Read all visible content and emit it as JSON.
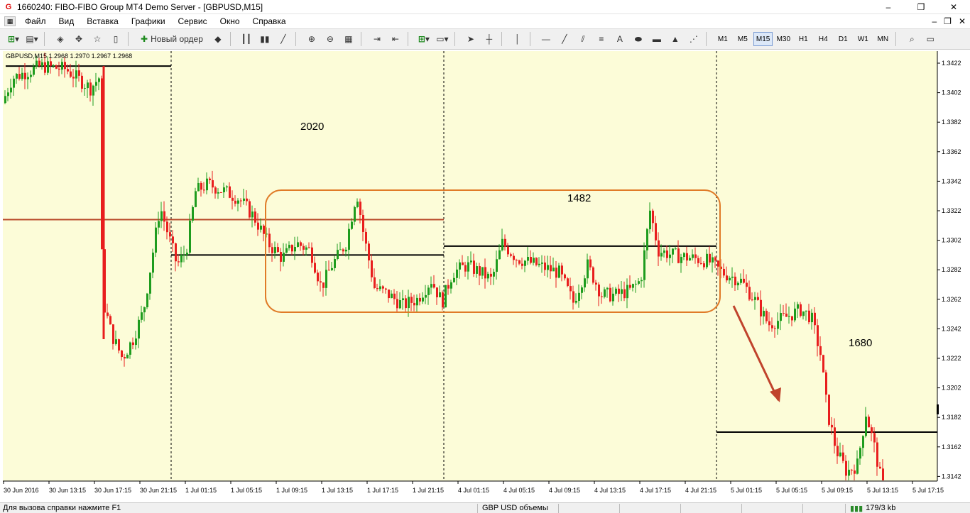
{
  "window": {
    "title": "1660240: FIBO-FIBO Group MT4 Demo Server - [GBPUSD,M15]",
    "controls": [
      "–",
      "❐",
      "✕"
    ]
  },
  "menu": {
    "items": [
      "Файл",
      "Вид",
      "Вставка",
      "Графики",
      "Сервис",
      "Окно",
      "Справка"
    ],
    "mdi_controls": [
      "–",
      "❐",
      "✕"
    ]
  },
  "toolbar": {
    "new_order_label": "Новый ордер",
    "timeframes": [
      "M1",
      "M5",
      "M15",
      "M30",
      "H1",
      "H4",
      "D1",
      "W1",
      "MN"
    ],
    "active_timeframe": "M15",
    "text_tool": "A"
  },
  "chart": {
    "info": "GBPUSD,M15  1.2968 1.2970 1.2967 1.2968",
    "colors": {
      "background": "#fcfcd8",
      "bull": "#1e9c1e",
      "bear": "#e81e1e",
      "range": "#e07b28",
      "arrow": "#c0432c",
      "level": "#b84a2a"
    },
    "annotations": [
      "2020",
      "1482",
      "1680"
    ],
    "price_labels": [
      "1.3422",
      "1.3402",
      "1.3382",
      "1.3362",
      "1.3342",
      "1.3322",
      "1.3302",
      "1.3282",
      "1.3262",
      "1.3242",
      "1.3222",
      "1.3202",
      "1.3182",
      "1.3162",
      "1.3142"
    ],
    "time_labels": [
      "30 Jun 2016",
      "30 Jun 13:15",
      "30 Jun 17:15",
      "30 Jun 21:15",
      "1 Jul 01:15",
      "1 Jul 05:15",
      "1 Jul 09:15",
      "1 Jul 13:15",
      "1 Jul 17:15",
      "1 Jul 21:15",
      "4 Jul 01:15",
      "4 Jul 05:15",
      "4 Jul 09:15",
      "4 Jul 13:15",
      "4 Jul 17:15",
      "4 Jul 21:15",
      "5 Jul 01:15",
      "5 Jul 05:15",
      "5 Jul 09:15",
      "5 Jul 13:15",
      "5 Jul 17:15"
    ]
  },
  "status": {
    "help": "Для вызова справки нажмите F1",
    "profile": "GBP USD объемы",
    "traffic": "179/3 kb"
  }
}
